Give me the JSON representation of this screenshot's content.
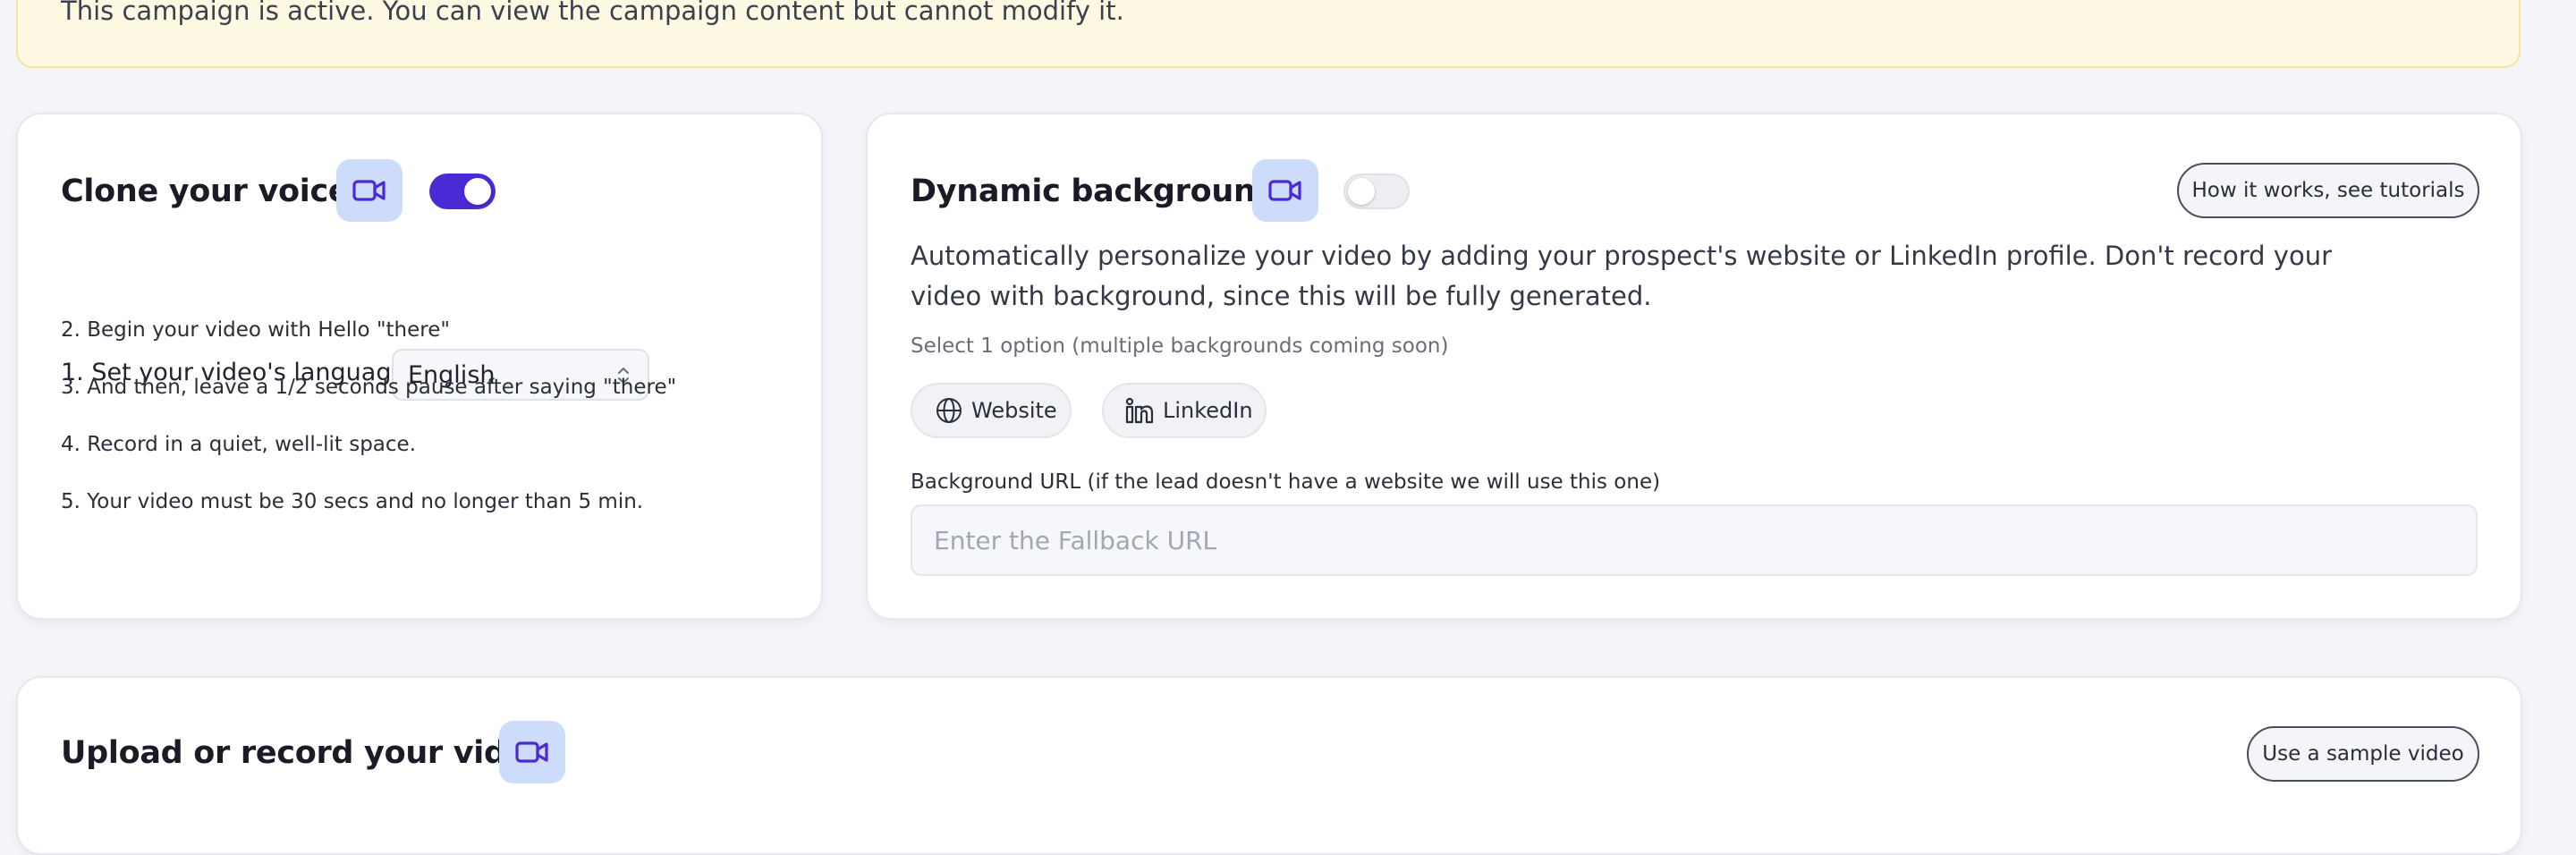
{
  "banner": {
    "text": "This campaign is active. You can view the campaign content but cannot modify it."
  },
  "clone_voice": {
    "title": "Clone your voice",
    "camera_icon": "video-camera-icon",
    "toggle_on": true,
    "language_label": "1. Set your video's language:",
    "language_value": "English",
    "steps": [
      "2. Begin your video with Hello \"there\"",
      "3. And then, leave a 1/2 seconds pause after saying \"there\"",
      "4. Record in a quiet, well-lit space.",
      "5. Your video must be 30 secs and no longer than 5 min."
    ]
  },
  "dynamic_background": {
    "title": "Dynamic background",
    "camera_icon": "video-camera-icon",
    "toggle_on": false,
    "tutorial_button": "How it works, see tutorials",
    "description": "Automatically personalize your video by adding your prospect's website or LinkedIn profile. Don't record your video with background, since this will be fully generated.",
    "hint": "Select 1 option (multiple backgrounds coming soon)",
    "options": [
      {
        "label": "Website",
        "icon": "globe-icon"
      },
      {
        "label": "LinkedIn",
        "icon": "linkedin-icon"
      }
    ],
    "url_label": "Background URL (if the lead doesn't have a website we will use this one)",
    "url_placeholder": "Enter the Fallback URL",
    "url_value": ""
  },
  "upload": {
    "title": "Upload or record your video",
    "camera_icon": "video-camera-icon",
    "sample_button": "Use a sample video"
  },
  "colors": {
    "accent": "#4b2ad6",
    "icon_badge": "#cddcfb",
    "banner_bg": "#fef9e3",
    "page_bg": "#f4f5f9"
  }
}
